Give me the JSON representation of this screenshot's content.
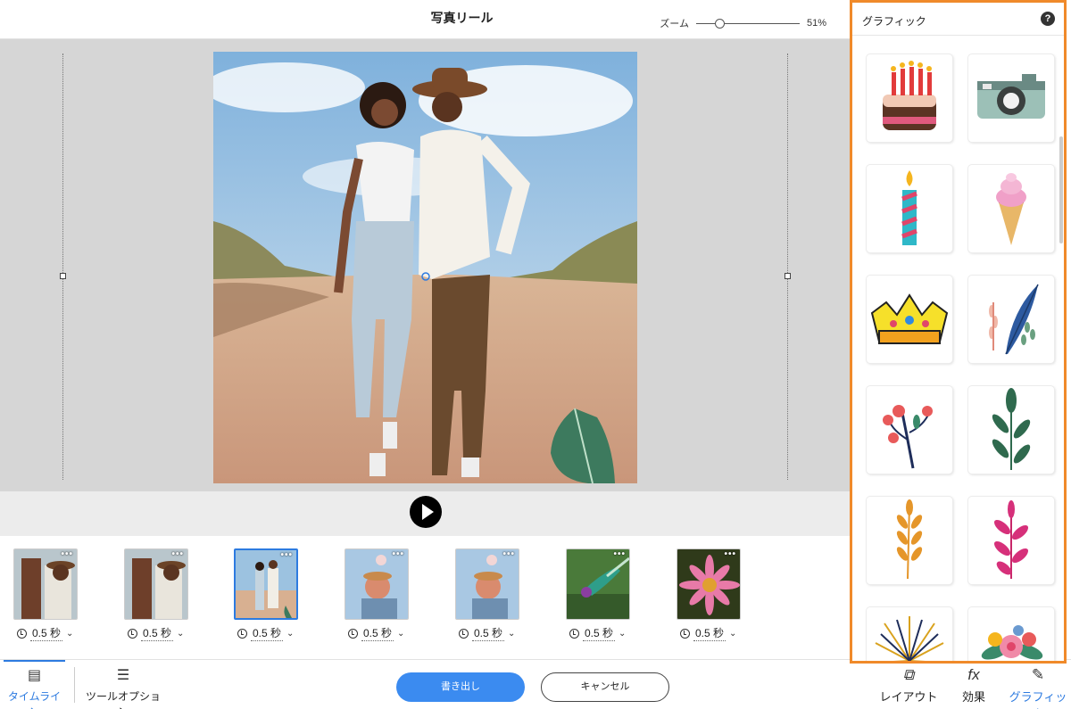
{
  "header": {
    "title": "写真リール",
    "zoom_label": "ズーム",
    "zoom_value": "51%",
    "zoom_level": 0.2
  },
  "clips": [
    {
      "duration": "0.5 秒",
      "selected": false,
      "scene": "couple-close"
    },
    {
      "duration": "0.5 秒",
      "selected": false,
      "scene": "couple-close"
    },
    {
      "duration": "0.5 秒",
      "selected": true,
      "scene": "couple-walk"
    },
    {
      "duration": "0.5 秒",
      "selected": false,
      "scene": "couple-balloon"
    },
    {
      "duration": "0.5 秒",
      "selected": false,
      "scene": "couple-balloon"
    },
    {
      "duration": "0.5 秒",
      "selected": false,
      "scene": "hummingbird"
    },
    {
      "duration": "0.5 秒",
      "selected": false,
      "scene": "flower"
    }
  ],
  "bottom_bar": {
    "timeline_label": "タイムライン",
    "tool_options_label": "ツールオプション",
    "export_label": "書き出し",
    "cancel_label": "キャンセル",
    "layout_label": "レイアウト",
    "effects_label": "効果",
    "graphics_label": "グラフィック"
  },
  "panel": {
    "title": "グラフィック",
    "help": "?",
    "items": [
      "cake",
      "camera",
      "candle",
      "ice-cream",
      "crown",
      "feathers",
      "berries",
      "leaf-branch",
      "wheat",
      "pink-branch",
      "fireworks",
      "bouquet"
    ]
  },
  "colors": {
    "accent": "#2d7be0",
    "highlight": "#f08a2a",
    "primary_button": "#3b8bf0"
  }
}
